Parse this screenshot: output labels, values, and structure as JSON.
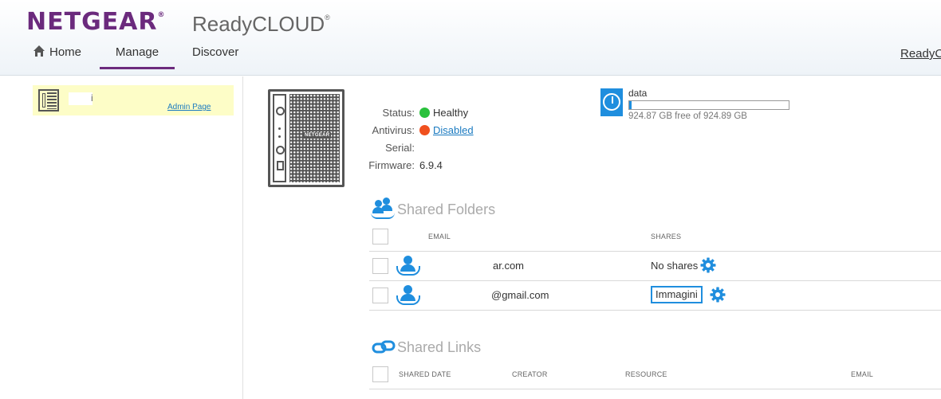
{
  "header": {
    "brand": "NETGEAR",
    "product": "ReadyCLOUD",
    "registered": "®",
    "tabs": [
      {
        "label": "Home",
        "active": false
      },
      {
        "label": "Manage",
        "active": true
      },
      {
        "label": "Discover",
        "active": false
      }
    ],
    "user_link": "ReadyC"
  },
  "sidebar": {
    "device_name_visible": "i",
    "admin_link": "Admin Page"
  },
  "device": {
    "nas_logo": "NETGEAR",
    "status": {
      "status_label": "Status:",
      "status_value": "Healthy",
      "antivirus_label": "Antivirus:",
      "antivirus_value": "Disabled",
      "serial_label": "Serial:",
      "serial_value": "",
      "firmware_label": "Firmware:",
      "firmware_value": "6.9.4"
    }
  },
  "volume": {
    "name": "data",
    "free_text": "924.87 GB free of 924.89 GB",
    "used_fraction": 0.0001
  },
  "shared_folders": {
    "title": "Shared Folders",
    "columns": [
      "EMAIL",
      "SHARES"
    ],
    "rows": [
      {
        "email": "ar.com",
        "shares": "No shares",
        "share_button": null
      },
      {
        "email": "@gmail.com",
        "shares": "",
        "share_button": "Immagini"
      }
    ]
  },
  "shared_links": {
    "title": "Shared Links",
    "columns": [
      "SHARED DATE",
      "CREATOR",
      "RESOURCE",
      "EMAIL"
    ]
  },
  "colors": {
    "brand_purple": "#6b2a7d",
    "accent_blue": "#1f8ede",
    "healthy_green": "#29c13c",
    "disabled_red": "#f0501e"
  }
}
